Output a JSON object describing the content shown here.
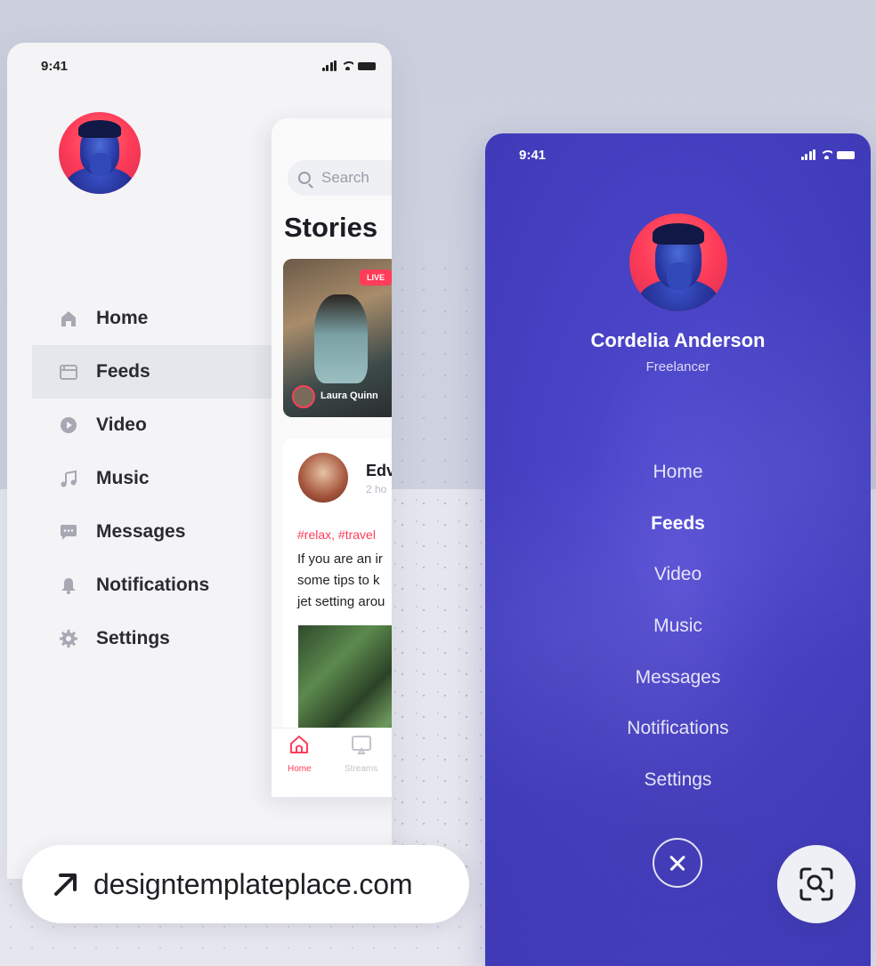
{
  "left_phone": {
    "status_time": "9:41",
    "menu": [
      {
        "label": "Home",
        "icon": "home-icon",
        "active": false
      },
      {
        "label": "Feeds",
        "icon": "feeds-icon",
        "active": true
      },
      {
        "label": "Video",
        "icon": "play-icon",
        "active": false
      },
      {
        "label": "Music",
        "icon": "music-icon",
        "active": false
      },
      {
        "label": "Messages",
        "icon": "message-icon",
        "active": false
      },
      {
        "label": "Notifications",
        "icon": "bell-icon",
        "active": false
      },
      {
        "label": "Settings",
        "icon": "gear-icon",
        "active": false
      }
    ],
    "app": {
      "search_placeholder": "Search",
      "stories_title": "Stories",
      "story_badge": "LIVE",
      "story_user": "Laura Quinn",
      "post": {
        "author": "Edv",
        "time": "2 ho",
        "tags": "#relax, #travel",
        "text_lines": [
          "If you are an ir",
          "some tips to k",
          "jet setting arou"
        ]
      },
      "tabs": [
        {
          "label": "Home",
          "icon": "home-outline-icon",
          "active": true
        },
        {
          "label": "Streams",
          "icon": "tv-icon",
          "active": false
        }
      ]
    }
  },
  "right_phone": {
    "status_time": "9:41",
    "user_name": "Cordelia Anderson",
    "user_role": "Freelancer",
    "menu": [
      {
        "label": "Home",
        "active": false
      },
      {
        "label": "Feeds",
        "active": true
      },
      {
        "label": "Video",
        "active": false
      },
      {
        "label": "Music",
        "active": false
      },
      {
        "label": "Messages",
        "active": false
      },
      {
        "label": "Notifications",
        "active": false
      },
      {
        "label": "Settings",
        "active": false
      }
    ]
  },
  "overlay": {
    "link_text": "designtemplateplace.com"
  },
  "colors": {
    "accent_red": "#ff3d5a",
    "purple_bg": "#4a44c8",
    "text_dark": "#2a2a33"
  }
}
